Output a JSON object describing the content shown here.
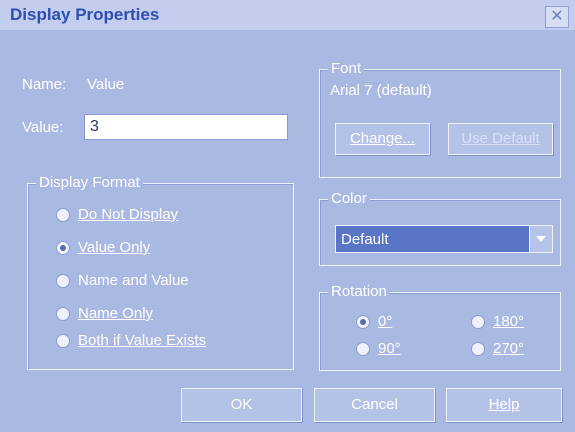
{
  "window": {
    "title": "Display Properties",
    "close_glyph": "✕"
  },
  "name_row": {
    "label": "Name:",
    "value": "Value"
  },
  "value_row": {
    "label": "Value:",
    "input_value": "3"
  },
  "display_format": {
    "legend": "Display Format",
    "options": [
      {
        "label": "Do Not Display",
        "checked": false
      },
      {
        "label": "Value Only",
        "checked": true
      },
      {
        "label": "Name and Value",
        "checked": false
      },
      {
        "label": "Name Only",
        "checked": false
      },
      {
        "label": "Both if Value Exists",
        "checked": false
      }
    ]
  },
  "font": {
    "legend": "Font",
    "current": "Arial 7 (default)",
    "change_label": "Change...",
    "use_default_label": "Use Default"
  },
  "color": {
    "legend": "Color",
    "selected": "Default"
  },
  "rotation": {
    "legend": "Rotation",
    "options": [
      {
        "label": "0°",
        "checked": true
      },
      {
        "label": "180°",
        "checked": false
      },
      {
        "label": "90°",
        "checked": false
      },
      {
        "label": "270°",
        "checked": false
      }
    ]
  },
  "footer": {
    "ok_label": "OK",
    "cancel_label": "Cancel",
    "help_label": "Help"
  }
}
